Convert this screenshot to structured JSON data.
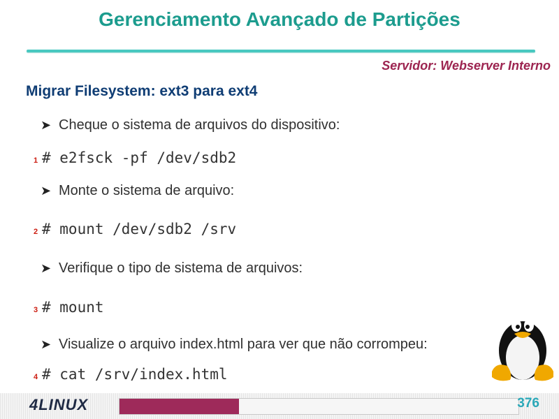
{
  "slide": {
    "title": "Gerenciamento Avançado de Partições",
    "server_label": "Servidor: Webserver Interno",
    "section_heading": "Migrar Filesystem:  ext3 para ext4",
    "steps": [
      {
        "bullet": "Cheque o sistema de arquivos do dispositivo:",
        "num": "1",
        "cmd": "# e2fsck -pf /dev/sdb2"
      },
      {
        "bullet": "Monte o sistema de arquivo:",
        "num": "2",
        "cmd": "# mount /dev/sdb2 /srv"
      },
      {
        "bullet": "Verifique o tipo de sistema de arquivos:",
        "num": "3",
        "cmd": "# mount"
      },
      {
        "bullet": "Visualize o arquivo index.html para ver que não corrompeu:",
        "num": "4",
        "cmd": "# cat /srv/index.html"
      }
    ]
  },
  "footer": {
    "logo_text": "4LINUX",
    "page_number": "376",
    "progress_fraction": 0.3
  },
  "icons": {
    "bullet": "arrow-bullet-icon",
    "mascot": "tux-penguin-icon"
  }
}
